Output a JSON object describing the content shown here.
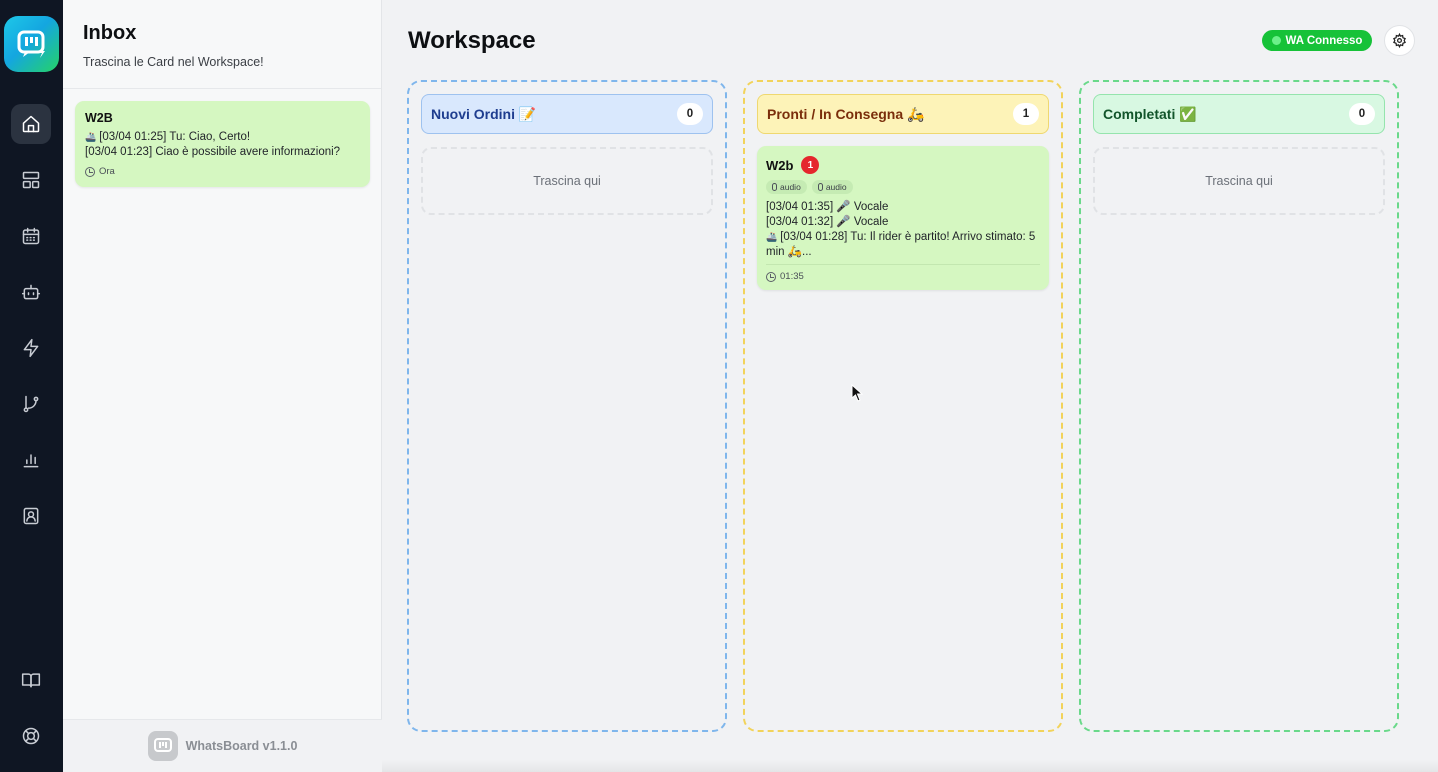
{
  "sidebar": {
    "items": [
      {
        "name": "home",
        "icon": "home-icon",
        "active": true
      },
      {
        "name": "dashboard",
        "icon": "layout-icon"
      },
      {
        "name": "calendar",
        "icon": "calendar-icon"
      },
      {
        "name": "bot",
        "icon": "bot-icon"
      },
      {
        "name": "automations",
        "icon": "bolt-icon"
      },
      {
        "name": "flows",
        "icon": "git-branch-icon"
      },
      {
        "name": "stats",
        "icon": "bar-chart-icon"
      },
      {
        "name": "contacts",
        "icon": "contact-icon"
      },
      {
        "name": "docs",
        "icon": "book-icon"
      },
      {
        "name": "help",
        "icon": "lifebuoy-icon"
      }
    ]
  },
  "inbox": {
    "title": "Inbox",
    "subtitle": "Trascina le Card nel Workspace!",
    "cards": [
      {
        "name": "W2B",
        "line1": "[03/04 01:25] Tu: Ciao, Certo!",
        "line2": "[03/04 01:23] Ciao è possibile avere informazioni?",
        "time": "Ora"
      }
    ],
    "footer": "WhatsBoard v1.1.0"
  },
  "workspace": {
    "title": "Workspace",
    "status_badge": "WA Connesso",
    "columns": [
      {
        "title": "Nuovi Ordini 📝",
        "count": "0",
        "dropzone": "Trascina qui"
      },
      {
        "title": "Pronti / In Consegna 🛵",
        "count": "1",
        "card": {
          "name": "W2b",
          "unread": "1",
          "tags": [
            "audio",
            "audio"
          ],
          "lines": [
            "[03/04 01:35] 🎤 Vocale",
            "[03/04 01:32] 🎤 Vocale",
            "[03/04 01:28] Tu: Il rider è partito! Arrivo stimato: 5",
            "min 🛵..."
          ],
          "time": "01:35"
        }
      },
      {
        "title": "Completati ✅",
        "count": "0",
        "dropzone": "Trascina qui"
      }
    ]
  },
  "colors": {
    "rail_bg": "#0f1623",
    "card_green": "#d5f7c1",
    "badge_green": "#16c238",
    "blue_border": "#7fb6ec",
    "yellow_border": "#f2d35a",
    "green_border": "#6ad98a",
    "unread_red": "#e5262d"
  }
}
